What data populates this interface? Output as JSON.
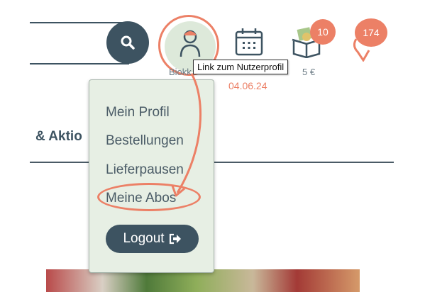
{
  "header": {
    "search": {
      "icon": "search-icon"
    },
    "user": {
      "icon": "user-icon",
      "label": "Biokk",
      "tooltip": "Link zum Nutzerprofil"
    },
    "delivery": {
      "icon": "calendar-icon",
      "date": "04.06.24"
    },
    "basket": {
      "icon": "basket-icon",
      "count": "10",
      "price": "5 €"
    },
    "wishlist": {
      "icon": "heart-icon",
      "count": "174"
    }
  },
  "nav": {
    "partial_label": "& Aktio"
  },
  "user_menu": {
    "items": [
      {
        "label": "Mein Profil"
      },
      {
        "label": "Bestellungen"
      },
      {
        "label": "Lieferpausen"
      },
      {
        "label": "Meine Abos"
      }
    ],
    "logout_label": "Logout",
    "logout_icon": "logout-icon"
  },
  "colors": {
    "primary": "#3d5361",
    "accent": "#ec8066",
    "menu_bg": "#e7efe4",
    "user_bg": "#dde9da"
  }
}
